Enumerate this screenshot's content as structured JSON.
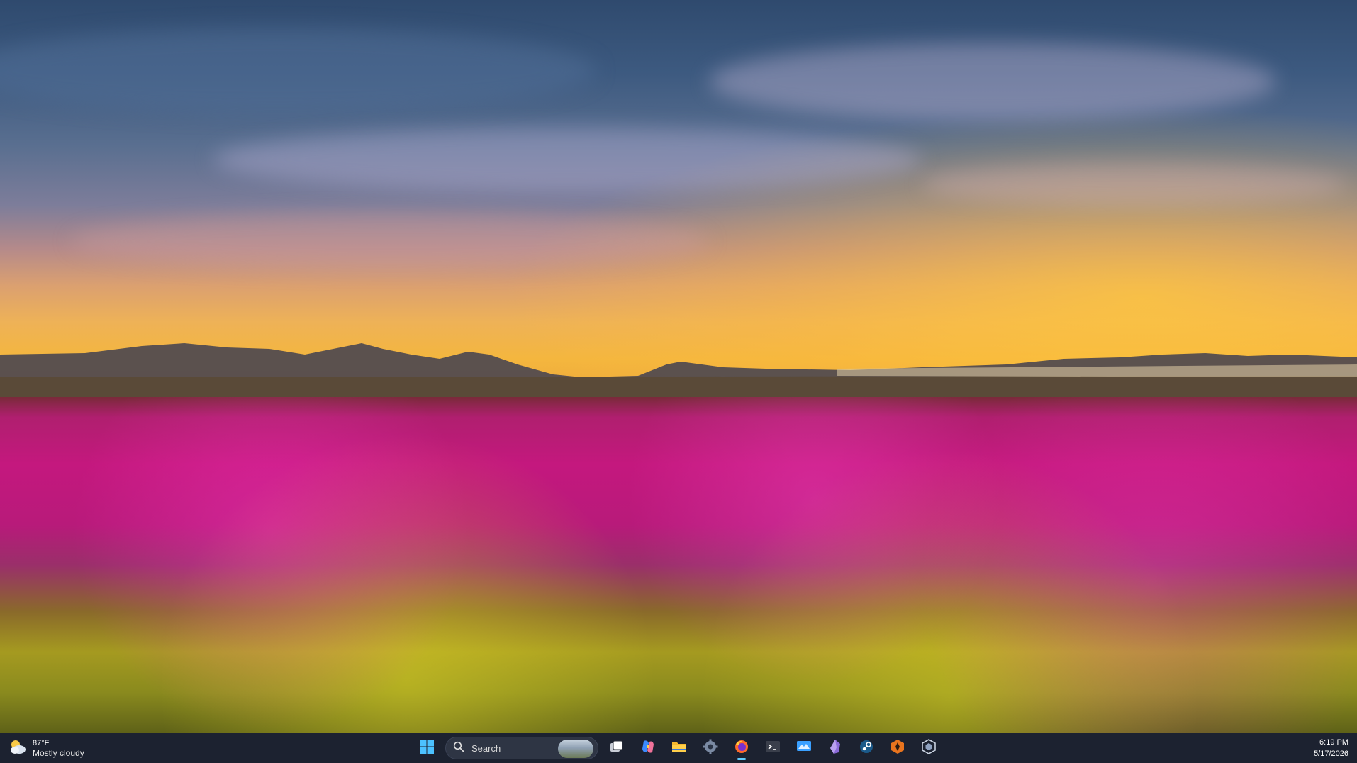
{
  "wallpaper": {
    "description_icon": "landscape-wallpaper"
  },
  "taskbar": {
    "weather": {
      "icon": "partly-cloudy-icon",
      "temperature": "87°F",
      "condition": "Mostly cloudy"
    },
    "search": {
      "placeholder": "Search",
      "icon": "search-icon"
    },
    "apps": [
      {
        "name": "start",
        "icon": "windows-start-icon"
      },
      {
        "name": "task-view",
        "icon": "task-view-icon"
      },
      {
        "name": "copilot",
        "icon": "copilot-icon"
      },
      {
        "name": "file-explorer",
        "icon": "folder-icon"
      },
      {
        "name": "settings",
        "icon": "gear-icon"
      },
      {
        "name": "firefox",
        "icon": "firefox-icon",
        "active": true
      },
      {
        "name": "terminal",
        "icon": "terminal-icon"
      },
      {
        "name": "remote-desktop",
        "icon": "monitor-icon"
      },
      {
        "name": "obsidian",
        "icon": "obsidian-icon"
      },
      {
        "name": "steam",
        "icon": "steam-icon"
      },
      {
        "name": "app-orange",
        "icon": "orange-app-icon"
      },
      {
        "name": "app-hexagon",
        "icon": "hexagon-icon"
      }
    ],
    "clock": {
      "time": "6:19 PM",
      "date": "5/17/2026"
    }
  },
  "colors": {
    "taskbar_bg": "#1c2230",
    "accent": "#60cdff"
  }
}
